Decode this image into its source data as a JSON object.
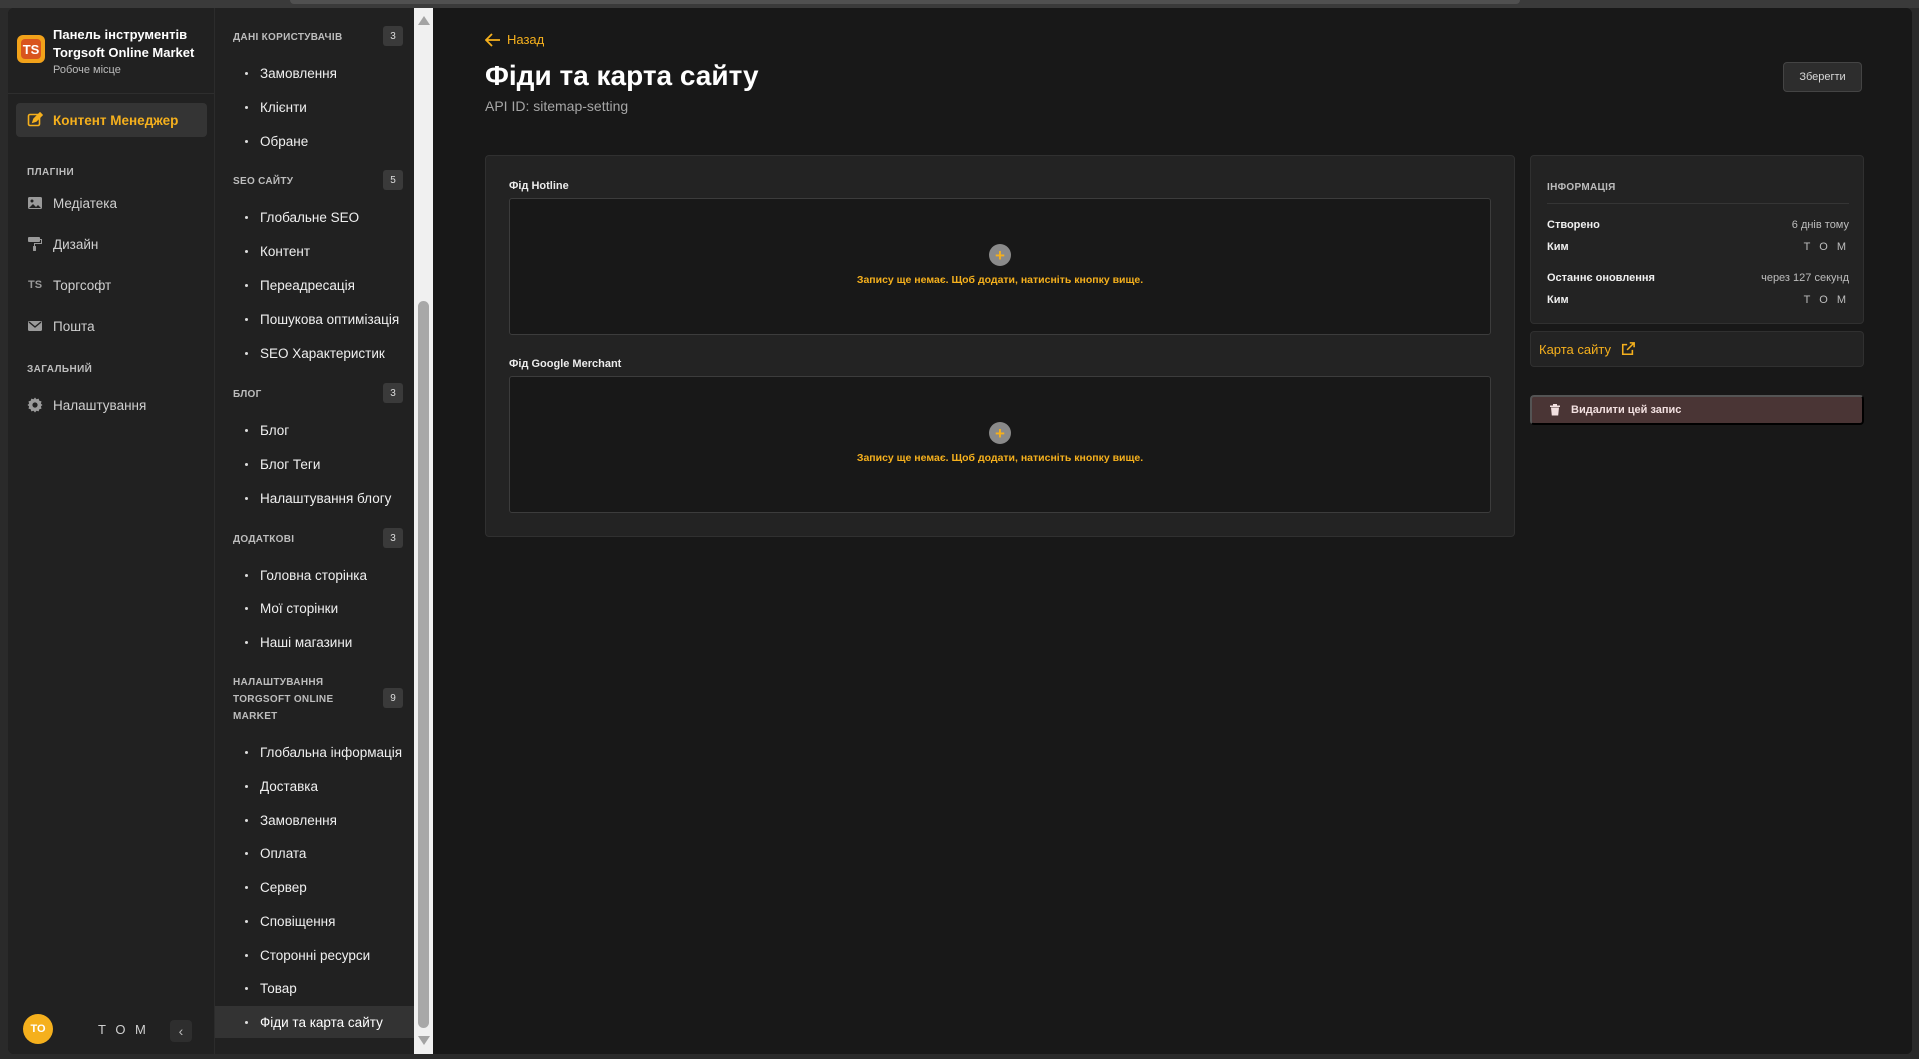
{
  "brand": {
    "line1": "Панель інструментів",
    "line2": "Torgsoft Online Market",
    "line3": "Робоче місце",
    "logo_text": "TS"
  },
  "leftnav": {
    "active_item": "Контент Менеджер",
    "section_plugins": "ПЛАГІНИ",
    "plugins": [
      {
        "label": "Медіатека",
        "icon": "image-icon"
      },
      {
        "label": "Дизайн",
        "icon": "paint-roller-icon"
      },
      {
        "label": "Торгсофт",
        "icon": "ts-icon"
      },
      {
        "label": "Пошта",
        "icon": "mail-icon"
      }
    ],
    "section_general": "ЗАГАЛЬНИЙ",
    "general": [
      {
        "label": "Налаштування",
        "icon": "gear-icon"
      }
    ],
    "user": {
      "initials": "TO",
      "name": "T O M"
    }
  },
  "subnav": {
    "sections": [
      {
        "title": "ДАНІ КОРИСТУВАЧІВ",
        "count": "3",
        "items": [
          "Замовлення",
          "Клієнти",
          "Обране"
        ]
      },
      {
        "title": "SEO САЙТУ",
        "count": "5",
        "items": [
          "Глобальне SEO",
          "Контент",
          "Переадресація",
          "Пошукова оптимізація",
          "SEO Характеристик"
        ]
      },
      {
        "title": "БЛОГ",
        "count": "3",
        "items": [
          "Блог",
          "Блог Теги",
          "Налаштування блогу"
        ]
      },
      {
        "title": "ДОДАТКОВІ",
        "count": "3",
        "items": [
          "Головна сторінка",
          "Мої сторінки",
          "Наші магазини"
        ]
      },
      {
        "title": "НАЛАШТУВАННЯ TORGSOFT ONLINE MARKET",
        "count": "9",
        "items": [
          "Глобальна інформація",
          "Доставка",
          "Замовлення",
          "Оплата",
          "Сервер",
          "Сповіщення",
          "Сторонні ресурси",
          "Товар",
          "Фіди та карта сайту"
        ]
      }
    ]
  },
  "main": {
    "back_label": "Назад",
    "title": "Фіди та карта сайту",
    "api_id": "API ID: sitemap-setting",
    "save_label": "Зберегти",
    "fields": [
      {
        "label": "Фід Hotline",
        "empty_text": "Запису ще немає. Щоб додати, натисніть кнопку вище."
      },
      {
        "label": "Фід Google Merchant",
        "empty_text": "Запису ще немає. Щоб додати, натисніть кнопку вище."
      }
    ],
    "info": {
      "title": "ІНФОРМАЦІЯ",
      "created_label": "Створено",
      "created_value": "6 днів тому",
      "by_label": "Ким",
      "by_value": "T O M",
      "updated_label": "Останнє оновлення",
      "updated_value": "через 127 секунд",
      "by2_label": "Ким",
      "by2_value": "T O M"
    },
    "sitemap_link": "Карта сайту",
    "delete_label": "Видалити цей запис"
  },
  "colors": {
    "accent": "#f5b01d",
    "background": "#181818",
    "panel": "#212121",
    "danger_bg": "#4a3535"
  }
}
